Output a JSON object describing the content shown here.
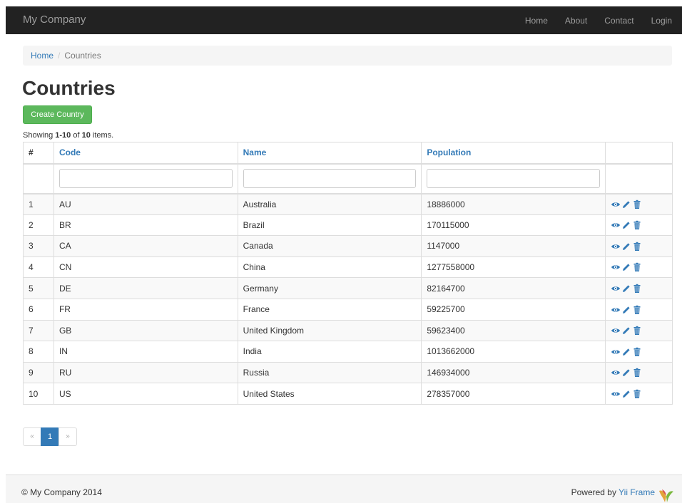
{
  "navbar": {
    "brand": "My Company",
    "links": [
      "Home",
      "About",
      "Contact",
      "Login"
    ]
  },
  "breadcrumb": {
    "home": "Home",
    "separator": "/",
    "current": "Countries"
  },
  "page": {
    "title": "Countries",
    "create_button": "Create Country"
  },
  "summary": {
    "prefix": "Showing ",
    "range": "1-10",
    "of": " of ",
    "total": "10",
    "suffix": " items."
  },
  "table": {
    "columns": {
      "serial": "#",
      "code": "Code",
      "name": "Name",
      "population": "Population"
    },
    "filters": {
      "code": "",
      "name": "",
      "population": ""
    },
    "rows": [
      {
        "n": "1",
        "code": "AU",
        "name": "Australia",
        "population": "18886000"
      },
      {
        "n": "2",
        "code": "BR",
        "name": "Brazil",
        "population": "170115000"
      },
      {
        "n": "3",
        "code": "CA",
        "name": "Canada",
        "population": "1147000"
      },
      {
        "n": "4",
        "code": "CN",
        "name": "China",
        "population": "1277558000"
      },
      {
        "n": "5",
        "code": "DE",
        "name": "Germany",
        "population": "82164700"
      },
      {
        "n": "6",
        "code": "FR",
        "name": "France",
        "population": "59225700"
      },
      {
        "n": "7",
        "code": "GB",
        "name": "United Kingdom",
        "population": "59623400"
      },
      {
        "n": "8",
        "code": "IN",
        "name": "India",
        "population": "1013662000"
      },
      {
        "n": "9",
        "code": "RU",
        "name": "Russia",
        "population": "146934000"
      },
      {
        "n": "10",
        "code": "US",
        "name": "United States",
        "population": "278357000"
      }
    ],
    "action_icons": [
      "eye-icon",
      "pencil-icon",
      "trash-icon"
    ]
  },
  "pagination": {
    "prev": "«",
    "current": "1",
    "next": "»"
  },
  "footer": {
    "copyright": "© My Company 2014",
    "powered_prefix": "Powered by ",
    "powered_link": "Yii Frame"
  },
  "colors": {
    "navbar_bg": "#222222",
    "link": "#337ab7",
    "success": "#5cb85c"
  }
}
